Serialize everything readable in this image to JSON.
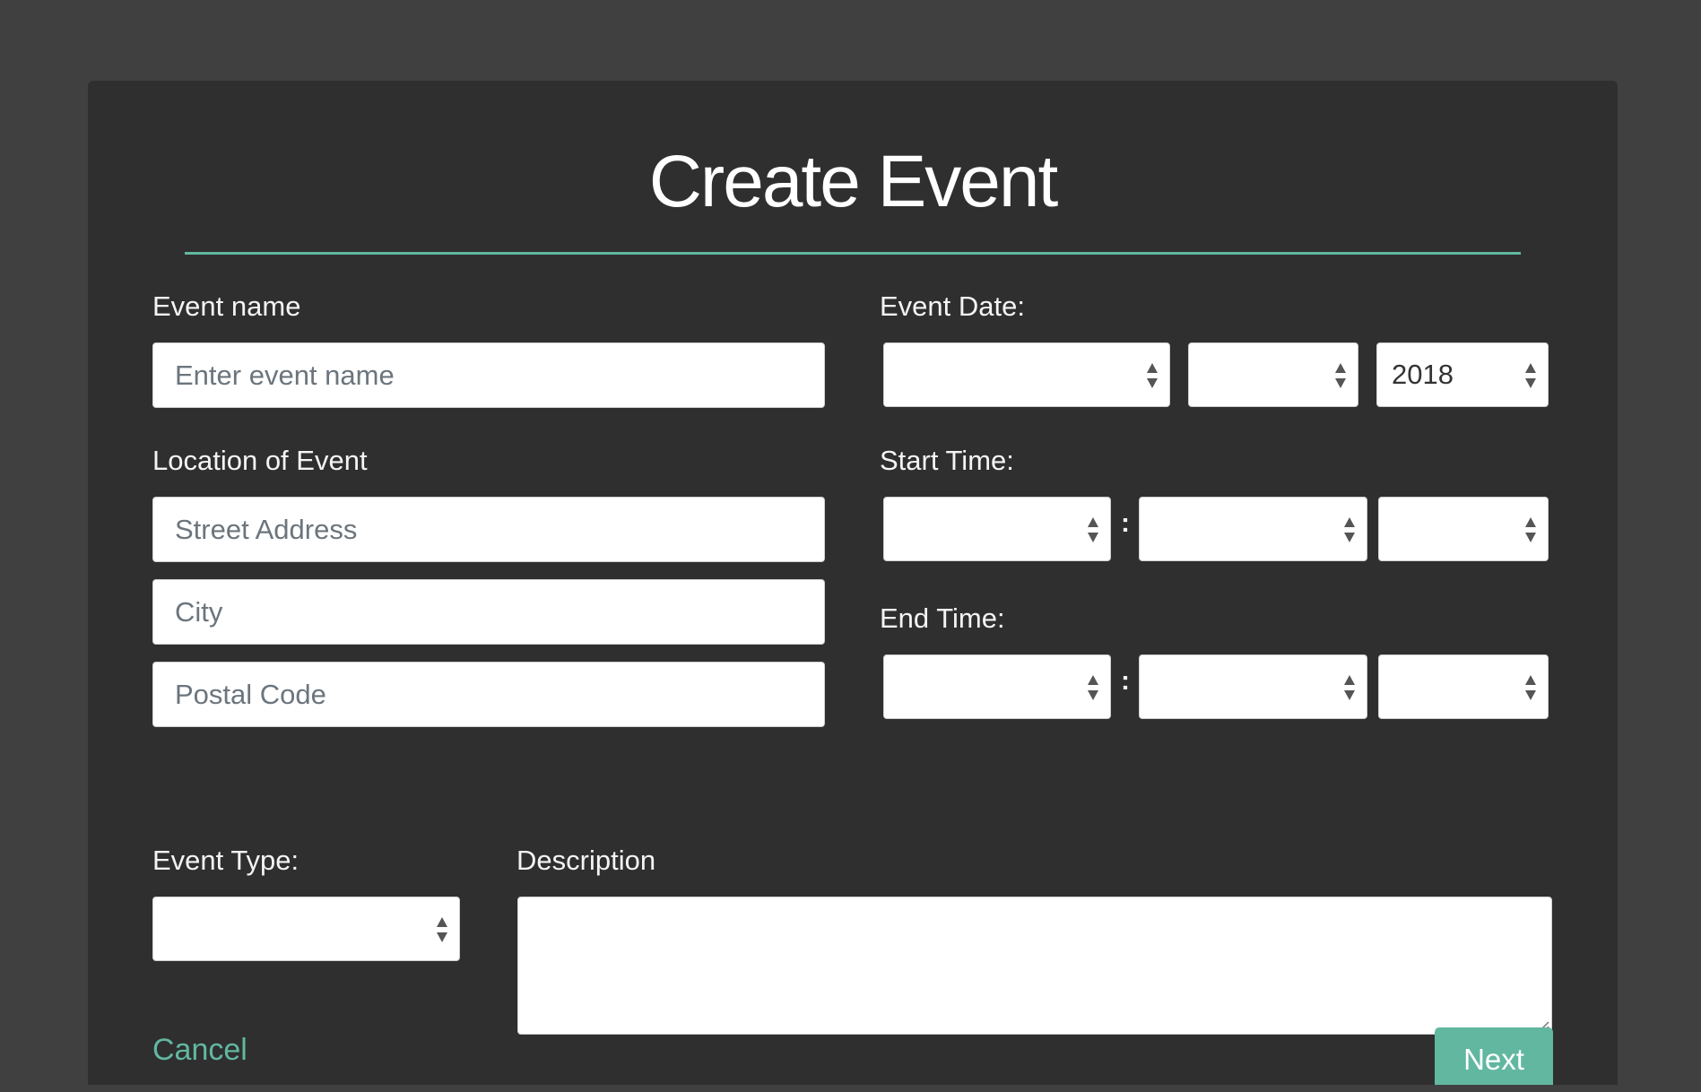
{
  "form": {
    "title": "Create Event",
    "event_name": {
      "label": "Event name",
      "placeholder": "Enter event name"
    },
    "location": {
      "label": "Location of Event",
      "street_placeholder": "Street Address",
      "city_placeholder": "City",
      "postal_placeholder": "Postal Code"
    },
    "event_date": {
      "label": "Event Date:",
      "month_value": "",
      "day_value": "",
      "year_value": "2018"
    },
    "start_time": {
      "label": "Start Time:",
      "separator": ":",
      "hour_value": "",
      "minute_value": "",
      "period_value": ""
    },
    "end_time": {
      "label": "End Time:",
      "separator": ":",
      "hour_value": "",
      "minute_value": "",
      "period_value": ""
    },
    "event_type": {
      "label": "Event Type:",
      "value": ""
    },
    "description": {
      "label": "Description",
      "value": ""
    },
    "cancel_label": "Cancel",
    "next_label": "Next"
  },
  "theme": {
    "accent": "#62b7a0",
    "page_background": "#404040",
    "panel_background": "#2f2f2f"
  }
}
